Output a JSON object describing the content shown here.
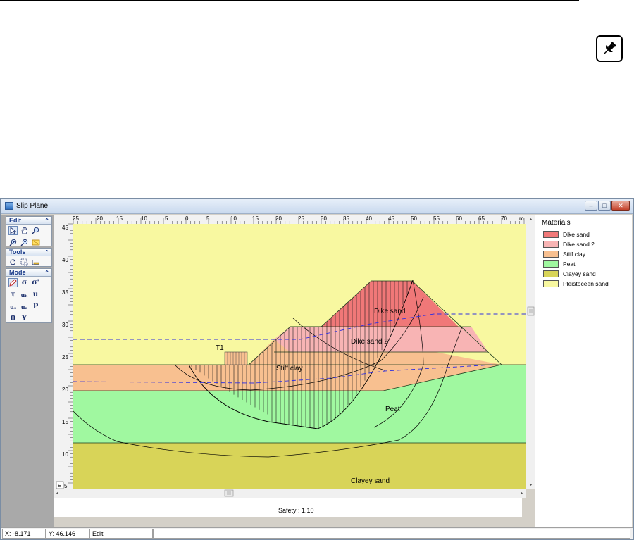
{
  "window": {
    "title": "Slip Plane",
    "buttons": {
      "minimize": "–",
      "maximize": "□",
      "close": "✕"
    }
  },
  "toolbox": {
    "edit": {
      "label": "Edit",
      "icons": [
        "select-arrow-icon",
        "pan-hand-icon",
        "zoom-icon",
        "zoom-in-icon",
        "zoom-out-icon",
        "zoom-window-icon"
      ]
    },
    "tools": {
      "label": "Tools",
      "icons": [
        "rotate-icon",
        "select-region-icon",
        "measure-icon"
      ]
    },
    "mode": {
      "label": "Mode",
      "symbols": [
        "σ",
        "σ'",
        "τ",
        "uₕ",
        "u",
        "uₛ",
        "uₐ",
        "P",
        "0",
        "Y"
      ]
    }
  },
  "ruler": {
    "x_labels": [
      "25",
      "20",
      "15",
      "10",
      "5",
      "0",
      "5",
      "10",
      "15",
      "20",
      "25",
      "30",
      "35",
      "40",
      "45",
      "50",
      "55",
      "60",
      "65",
      "70",
      "m"
    ],
    "y_labels": [
      "45",
      "40",
      "35",
      "30",
      "25",
      "20",
      "15",
      "10",
      "5"
    ],
    "corner_label": "E"
  },
  "canvas": {
    "labels": {
      "dike_sand": "Dike sand",
      "dike_sand_2": "Dike sand 2",
      "stiff_clay": "Stiff clay",
      "peat": "Peat",
      "clayey_sand": "Clayey sand",
      "load": "T1"
    },
    "safety": "Safety : 1.10"
  },
  "materials": {
    "title": "Materials",
    "items": [
      {
        "name": "Dike sand",
        "color": "#f07878"
      },
      {
        "name": "Dike sand 2",
        "color": "#f8b4b4"
      },
      {
        "name": "Stiff clay",
        "color": "#f8c090"
      },
      {
        "name": "Peat",
        "color": "#a0f8a0"
      },
      {
        "name": "Clayey sand",
        "color": "#d8d458"
      },
      {
        "name": "Pleistoceen sand",
        "color": "#f8f8a0"
      }
    ]
  },
  "statusbar": {
    "x": "X: -8.171",
    "y": "Y: 46.146",
    "mode": "Edit"
  }
}
